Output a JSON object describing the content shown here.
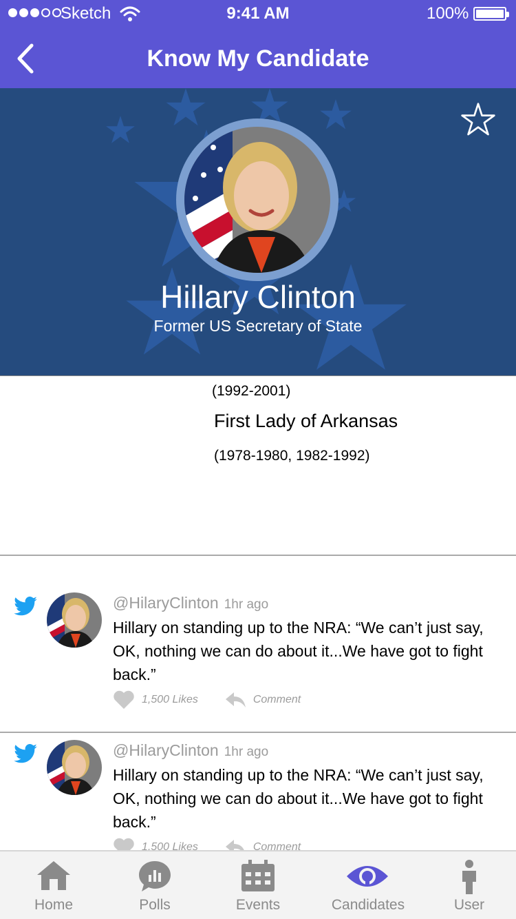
{
  "status_bar": {
    "carrier": "Sketch",
    "time": "9:41 AM",
    "battery": "100%"
  },
  "nav": {
    "title": "Know My Candidate"
  },
  "profile": {
    "name": "Hillary Clinton",
    "role": "Former US Secretary of State"
  },
  "career": {
    "years_first": "(1992-2001)",
    "position": "First Lady of Arkansas",
    "years_second": "(1978-1980, 1982-1992)"
  },
  "tweets": [
    {
      "handle": "@HilaryClinton",
      "time": "1hr ago",
      "text": "Hillary on standing up to the NRA: “We can’t just say, OK, nothing we can do about it...We have got to fight back.”",
      "likes": "1,500 Likes",
      "comment": "Comment"
    },
    {
      "handle": "@HilaryClinton",
      "time": "1hr ago",
      "text": "Hillary on standing up to the NRA: “We can’t just say, OK, nothing we can do about it...We have got to fight back.”",
      "likes": "1,500 Likes",
      "comment": "Comment"
    }
  ],
  "tabs": [
    {
      "label": "Home",
      "icon": "home-icon"
    },
    {
      "label": "Polls",
      "icon": "polls-icon"
    },
    {
      "label": "Events",
      "icon": "calendar-icon"
    },
    {
      "label": "Candidates",
      "icon": "eye-icon"
    },
    {
      "label": "User",
      "icon": "user-icon"
    }
  ],
  "colors": {
    "accent": "#5b55d4",
    "hero_bg": "#254b7e",
    "twitter": "#1da1f2",
    "muted": "#8a8a8a"
  }
}
